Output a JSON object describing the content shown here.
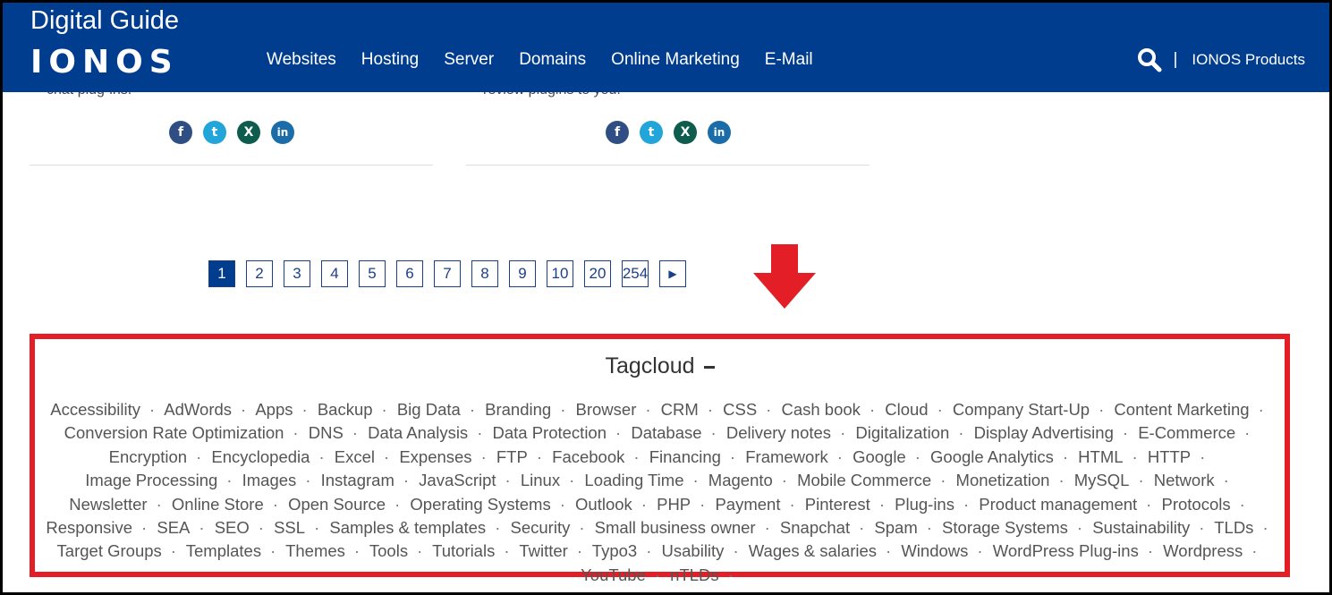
{
  "header": {
    "title": "Digital Guide",
    "logo": "IONOS",
    "nav": [
      "Websites",
      "Hosting",
      "Server",
      "Domains",
      "Online Marketing",
      "E-Mail"
    ],
    "separator": "|",
    "products_label": "IONOS Products",
    "icons": [
      "search-icon"
    ]
  },
  "articles": [
    {
      "cut_text": "chat plug-ins."
    },
    {
      "cut_text": "review plugins to you."
    }
  ],
  "social": {
    "facebook": "f",
    "twitter": "t",
    "xing": "X",
    "linkedin": "in"
  },
  "pagination": {
    "pages": [
      "1",
      "2",
      "3",
      "4",
      "5",
      "6",
      "7",
      "8",
      "9",
      "10",
      "20",
      "254"
    ],
    "active": "1",
    "next_icon": "▶"
  },
  "tagcloud": {
    "title": "Tagcloud",
    "tags": [
      "Accessibility",
      "AdWords",
      "Apps",
      "Backup",
      "Big Data",
      "Branding",
      "Browser",
      "CRM",
      "CSS",
      "Cash book",
      "Cloud",
      "Company Start-Up",
      "Content Marketing",
      "Conversion Rate Optimization",
      "DNS",
      "Data Analysis",
      "Data Protection",
      "Database",
      "Delivery notes",
      "Digitalization",
      "Display Advertising",
      "E-Commerce",
      "Encryption",
      "Encyclopedia",
      "Excel",
      "Expenses",
      "FTP",
      "Facebook",
      "Financing",
      "Framework",
      "Google",
      "Google Analytics",
      "HTML",
      "HTTP",
      "Image Processing",
      "Images",
      "Instagram",
      "JavaScript",
      "Linux",
      "Loading Time",
      "Magento",
      "Mobile Commerce",
      "Monetization",
      "MySQL",
      "Network",
      "Newsletter",
      "Online Store",
      "Open Source",
      "Operating Systems",
      "Outlook",
      "PHP",
      "Payment",
      "Pinterest",
      "Plug-ins",
      "Product management",
      "Protocols",
      "Responsive",
      "SEA",
      "SEO",
      "SSL",
      "Samples & templates",
      "Security",
      "Small business owner",
      "Snapchat",
      "Spam",
      "Storage Systems",
      "Sustainability",
      "TLDs",
      "Target Groups",
      "Templates",
      "Themes",
      "Tools",
      "Tutorials",
      "Twitter",
      "Typo3",
      "Usability",
      "Wages & salaries",
      "Windows",
      "WordPress Plug-ins",
      "Wordpress",
      "YouTube",
      "nTLDs"
    ]
  },
  "colors": {
    "header_bg": "#003d8f",
    "highlight_red": "#e41e26",
    "page_border": "#1b3f8b"
  }
}
